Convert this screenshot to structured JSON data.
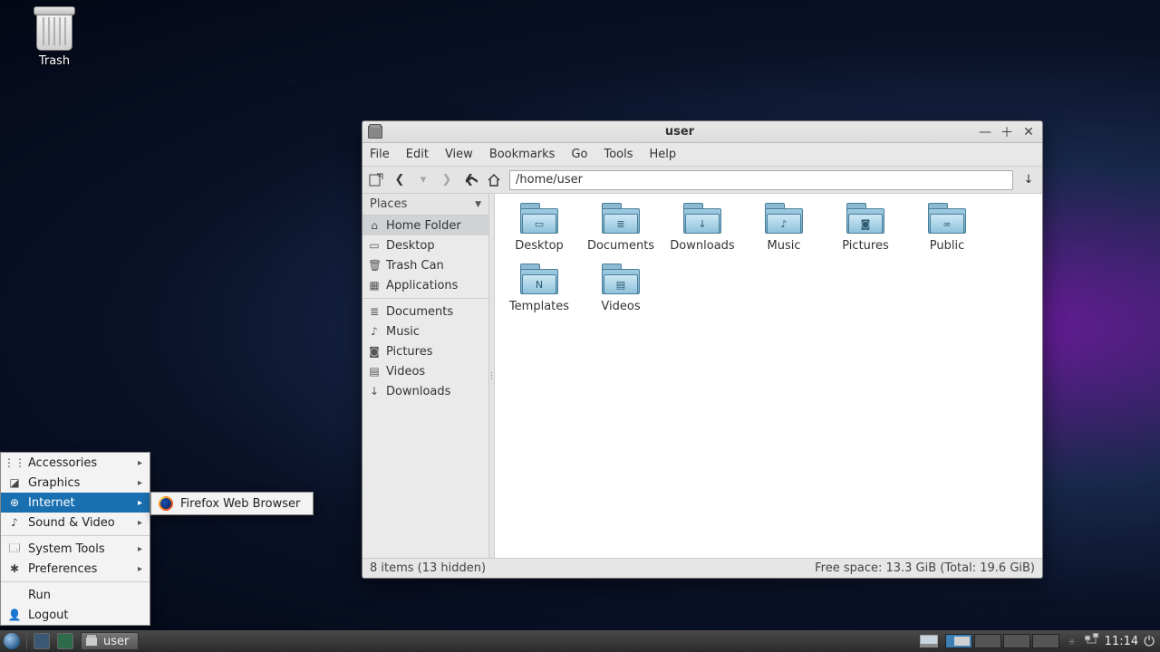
{
  "desktop": {
    "trash_label": "Trash"
  },
  "window": {
    "title": "user",
    "menu": [
      "File",
      "Edit",
      "View",
      "Bookmarks",
      "Go",
      "Tools",
      "Help"
    ],
    "path": "/home/user",
    "sidebar_header": "Places",
    "sidebar": {
      "main": [
        {
          "icon": "home",
          "label": "Home Folder",
          "selected": true
        },
        {
          "icon": "desktop",
          "label": "Desktop"
        },
        {
          "icon": "trash",
          "label": "Trash Can"
        },
        {
          "icon": "apps",
          "label": "Applications"
        }
      ],
      "bookmarks": [
        {
          "icon": "doc",
          "label": "Documents"
        },
        {
          "icon": "music",
          "label": "Music"
        },
        {
          "icon": "pic",
          "label": "Pictures"
        },
        {
          "icon": "vid",
          "label": "Videos"
        },
        {
          "icon": "down",
          "label": "Downloads"
        }
      ]
    },
    "folders": [
      {
        "name": "Desktop",
        "glyph": "▭"
      },
      {
        "name": "Documents",
        "glyph": "≣"
      },
      {
        "name": "Downloads",
        "glyph": "↓"
      },
      {
        "name": "Music",
        "glyph": "♪"
      },
      {
        "name": "Pictures",
        "glyph": "◙"
      },
      {
        "name": "Public",
        "glyph": "∞"
      },
      {
        "name": "Templates",
        "glyph": "N"
      },
      {
        "name": "Videos",
        "glyph": "▤"
      }
    ],
    "status_left": "8 items (13 hidden)",
    "status_right": "Free space: 13.3 GiB (Total: 19.6 GiB)"
  },
  "appmenu": {
    "top": [
      {
        "label": "Accessories",
        "icon": "⋮⋮",
        "arrow": true
      },
      {
        "label": "Graphics",
        "icon": "◪",
        "arrow": true
      },
      {
        "label": "Internet",
        "icon": "⊕",
        "arrow": true,
        "highlight": true
      },
      {
        "label": "Sound & Video",
        "icon": "♪",
        "arrow": true
      }
    ],
    "mid": [
      {
        "label": "System Tools",
        "icon": "🗔",
        "arrow": true
      },
      {
        "label": "Preferences",
        "icon": "✱",
        "arrow": true
      }
    ],
    "bottom": [
      {
        "label": "Run",
        "icon": "",
        "arrow": false
      },
      {
        "label": "Logout",
        "icon": "👤",
        "arrow": false
      }
    ],
    "submenu": [
      {
        "label": "Firefox Web Browser"
      }
    ]
  },
  "panel": {
    "task_label": "user",
    "clock": "11:14"
  }
}
